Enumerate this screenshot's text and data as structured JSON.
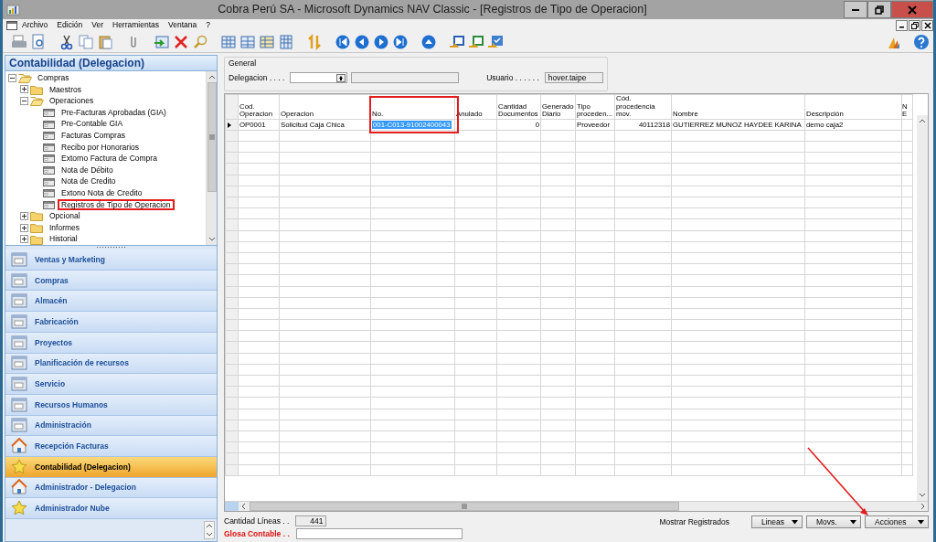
{
  "window": {
    "title": "Cobra Perú SA - Microsoft Dynamics NAV Classic - [Registros de Tipo de Operacion]"
  },
  "menu": [
    "Archivo",
    "Edición",
    "Ver",
    "Herramientas",
    "Ventana",
    "?"
  ],
  "navigation_pane": {
    "title": "Contabilidad (Delegacion)",
    "tree": [
      {
        "label": "Compras",
        "kind": "folder",
        "expanded": true,
        "annotated": false,
        "children": [
          {
            "label": "Maestros",
            "kind": "folder",
            "expanded": false,
            "annotated": false
          },
          {
            "label": "Operaciones",
            "kind": "folder",
            "expanded": true,
            "annotated": false,
            "children": [
              {
                "label": "Pre-Facturas Aprobadas (GIA)",
                "kind": "page",
                "annotated": false
              },
              {
                "label": "Pre-Contable GIA",
                "kind": "page",
                "annotated": false
              },
              {
                "label": "Facturas Compras",
                "kind": "page",
                "annotated": false
              },
              {
                "label": "Recibo por Honorarios",
                "kind": "page",
                "annotated": false
              },
              {
                "label": "Extorno Factura de Compra",
                "kind": "page",
                "annotated": false
              },
              {
                "label": "Nota de Débito",
                "kind": "page",
                "annotated": false
              },
              {
                "label": "Nota de Credito",
                "kind": "page",
                "annotated": false
              },
              {
                "label": "Extono Nota de Credito",
                "kind": "page",
                "annotated": false
              },
              {
                "label": "Registros de Tipo de Operacion",
                "kind": "page",
                "annotated": true
              }
            ]
          },
          {
            "label": "Opcional",
            "kind": "folder",
            "expanded": false,
            "annotated": false
          },
          {
            "label": "Informes",
            "kind": "folder",
            "expanded": false,
            "annotated": false
          },
          {
            "label": "Historial",
            "kind": "folder",
            "expanded": false,
            "annotated": false
          }
        ]
      }
    ],
    "modules": [
      {
        "label": "Ventas y Marketing",
        "selected": false
      },
      {
        "label": "Compras",
        "selected": false
      },
      {
        "label": "Almacén",
        "selected": false
      },
      {
        "label": "Fabricación",
        "selected": false
      },
      {
        "label": "Proyectos",
        "selected": false
      },
      {
        "label": "Planificación de recursos",
        "selected": false
      },
      {
        "label": "Servicio",
        "selected": false
      },
      {
        "label": "Recursos Humanos",
        "selected": false
      },
      {
        "label": "Administración",
        "selected": false
      },
      {
        "label": "Recepción  Facturas",
        "selected": false
      },
      {
        "label": "Contabilidad (Delegacion)",
        "selected": true
      },
      {
        "label": "Administrador - Delegacion",
        "selected": false
      },
      {
        "label": "Administrador Nube",
        "selected": false
      }
    ]
  },
  "general": {
    "legend": "General",
    "fields": [
      {
        "label": "Delegacion . . . .",
        "kind": "lookup"
      },
      {
        "label": "Usuario . . . . . .",
        "kind": "readonly",
        "value": "hover.taipe"
      }
    ]
  },
  "grid": {
    "columns": [
      {
        "label": "Cod. Operacion",
        "kind": "text",
        "annotated": false
      },
      {
        "label": "Operacion",
        "kind": "text",
        "annotated": false
      },
      {
        "label": "No.",
        "kind": "text",
        "annotated": true
      },
      {
        "label": "Anulado",
        "kind": "text",
        "annotated": false
      },
      {
        "label": "Cantidad Documentos",
        "kind": "number",
        "annotated": false
      },
      {
        "label": "Generado Diario",
        "kind": "text",
        "annotated": false
      },
      {
        "label": "Tipo proceden...",
        "kind": "text",
        "annotated": false
      },
      {
        "label": "Cód. procedencia mov.",
        "kind": "number",
        "annotated": false
      },
      {
        "label": "Nombre",
        "kind": "text",
        "annotated": false
      },
      {
        "label": "Descripción",
        "kind": "text",
        "annotated": false
      },
      {
        "label": "N E",
        "kind": "text",
        "annotated": false
      }
    ],
    "rows": [
      {
        "current": true,
        "cells": [
          {
            "text": "OP0001",
            "selected": false
          },
          {
            "text": "Solicitud Caja Chica",
            "selected": false
          },
          {
            "text": "001-C013-91002400043",
            "selected": true
          },
          {
            "text": null,
            "selected": false
          },
          {
            "text": "0",
            "selected": false
          },
          {
            "text": null,
            "selected": false
          },
          {
            "text": "Proveedor",
            "selected": false
          },
          {
            "text": "40112318",
            "selected": false
          },
          {
            "text": "GUTIERREZ MUNOZ HAYDEE KARINA",
            "selected": false
          },
          {
            "text": "demo caja2",
            "selected": false
          },
          {
            "text": null,
            "selected": false
          }
        ]
      }
    ]
  },
  "footer": {
    "fields": [
      {
        "label": "Cantidad Líneas . .",
        "kind": "readonly",
        "value": "441",
        "required": false
      },
      {
        "label": "Glosa Contable . .",
        "kind": "input",
        "required": true
      }
    ],
    "filter_label": "Mostrar Registrados",
    "buttons": [
      {
        "label": "Lineas",
        "annotated": false
      },
      {
        "label": "Movs.",
        "annotated": false
      },
      {
        "label": "Acciones",
        "annotated": true
      }
    ]
  }
}
